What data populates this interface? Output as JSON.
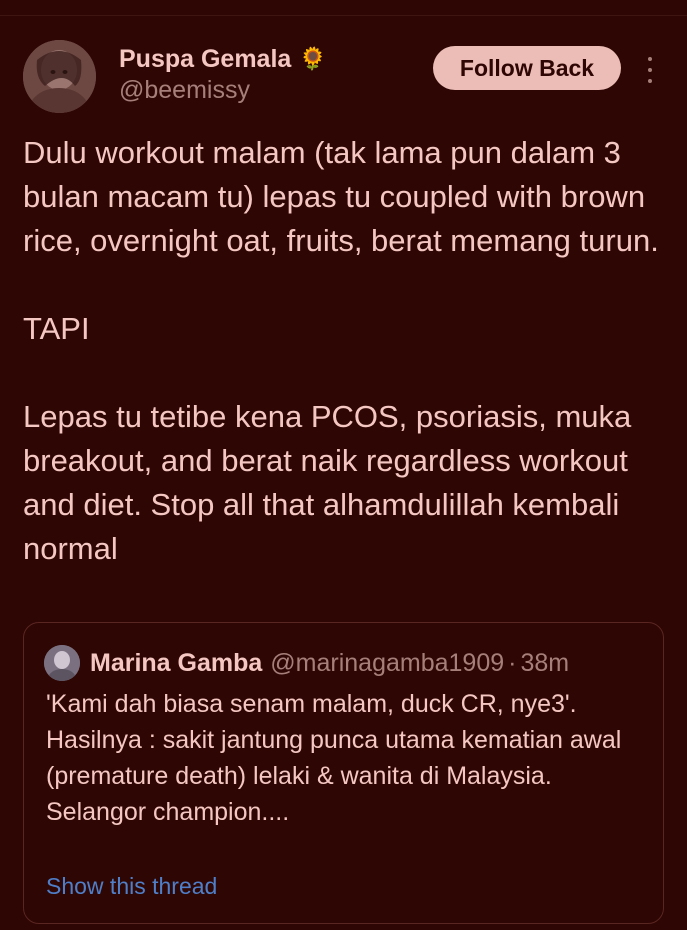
{
  "tweet": {
    "author": {
      "display_name": "Puspa Gemala",
      "emoji": "🌻",
      "handle": "@beemissy"
    },
    "follow_button_label": "Follow Back",
    "text": "Dulu workout malam (tak lama pun dalam 3 bulan macam tu) lepas tu coupled with brown rice, overnight oat, fruits, berat memang turun.\n\nTAPI\n\nLepas tu tetibe kena PCOS, psoriasis, muka breakout, and berat naik regardless workout and diet. Stop all that alhamdulillah kembali normal",
    "quote": {
      "display_name": "Marina Gamba",
      "handle": "@marinagamba1909",
      "separator": "·",
      "time": "38m",
      "text": "'Kami dah biasa senam malam, duck CR, nye3'.\nHasilnya : sakit jantung punca utama kematian awal (premature death) lelaki & wanita di Malaysia.\nSelangor champion....",
      "show_thread_label": "Show this thread"
    }
  },
  "colors": {
    "background": "#2e0604",
    "text_primary": "#f4c7c2",
    "text_secondary": "#a77f7a",
    "button_bg": "#ecbdb6",
    "link": "#4f7fc9"
  }
}
